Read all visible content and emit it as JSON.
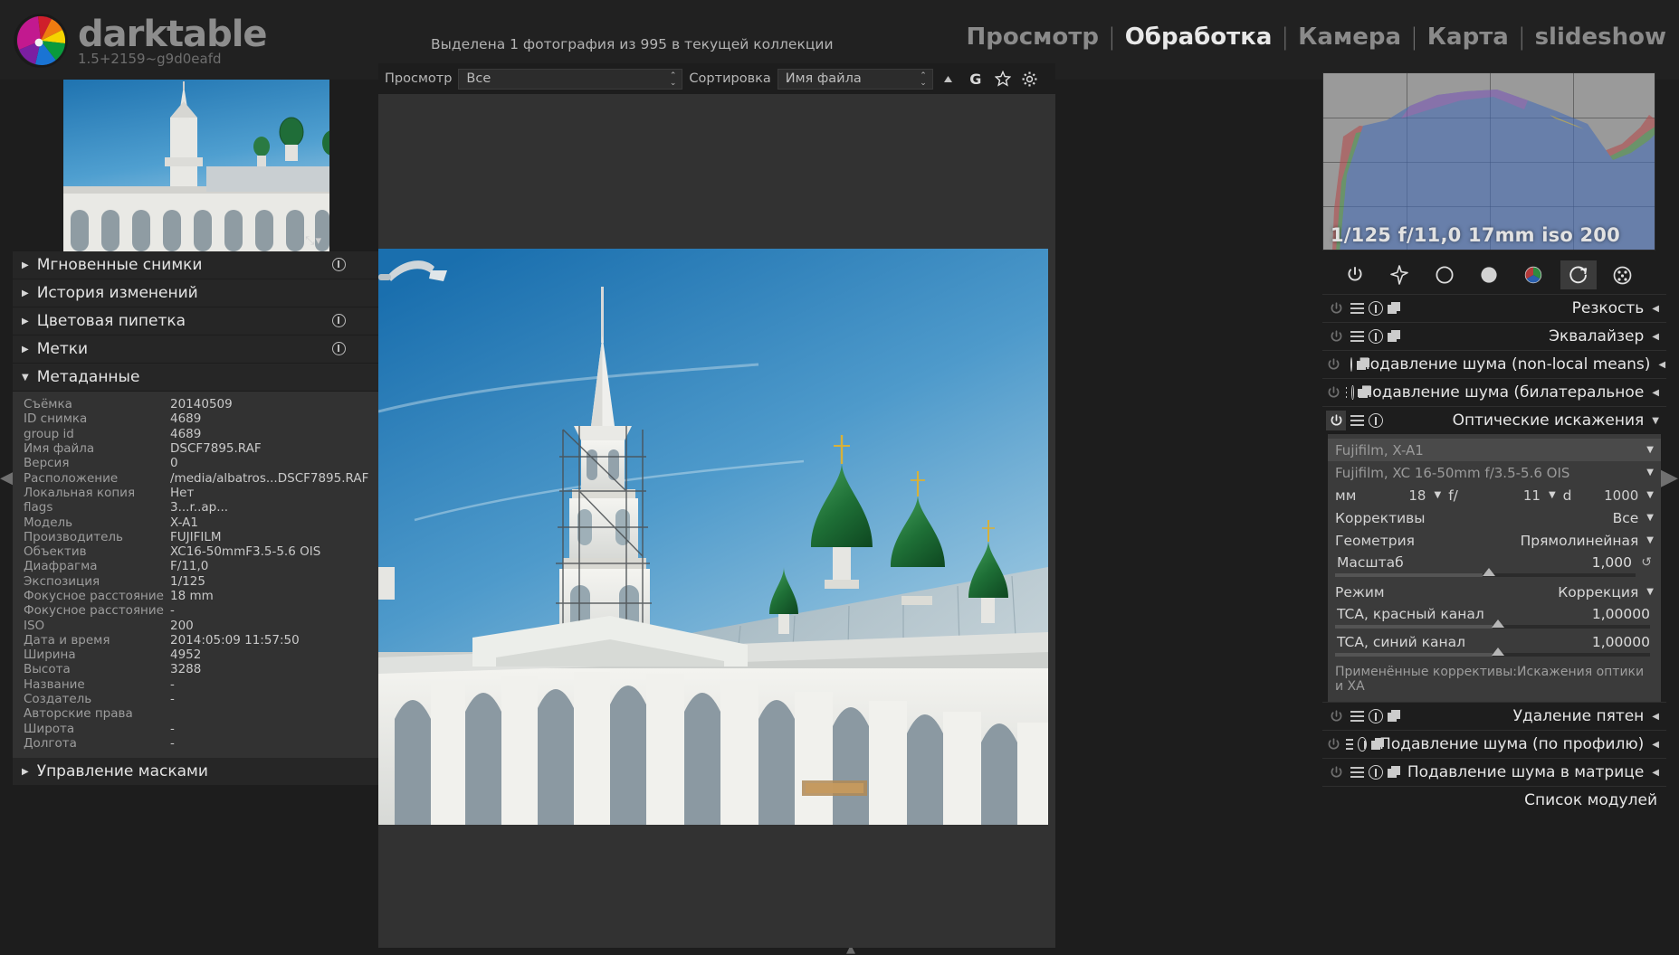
{
  "app": {
    "name": "darktable",
    "version": "1.5+2159~g9d0eafd",
    "collection_status": "Выделена 1 фотография из 995 в текущей коллекции"
  },
  "viewnav": {
    "items": [
      {
        "label": "Просмотр",
        "active": false
      },
      {
        "label": "Обработка",
        "active": true
      },
      {
        "label": "Камера",
        "active": false
      },
      {
        "label": "Карта",
        "active": false
      },
      {
        "label": "slideshow",
        "active": false
      }
    ],
    "separator": "|"
  },
  "toolbar": {
    "view_label": "Просмотр",
    "view_value": "Все",
    "sort_label": "Сортировка",
    "sort_value": "Имя файла",
    "asc_icon": "triangle-up-icon",
    "group_icon": "G",
    "overlay_icon": "star-icon",
    "prefs_icon": "gear-icon"
  },
  "left_panel": {
    "thumb_resize_icon": "resize-icon",
    "sections": [
      {
        "label": "Мгновенные снимки",
        "expanded": false,
        "has_reset": true
      },
      {
        "label": "История изменений",
        "expanded": false,
        "has_reset": false
      },
      {
        "label": "Цветовая пипетка",
        "expanded": false,
        "has_reset": true
      },
      {
        "label": "Метки",
        "expanded": false,
        "has_reset": true
      },
      {
        "label": "Метаданные",
        "expanded": true,
        "has_reset": false
      }
    ],
    "masks_section": {
      "label": "Управление масками",
      "expanded": false
    },
    "metadata": [
      {
        "key": "Съёмка",
        "value": "20140509"
      },
      {
        "key": "ID снимка",
        "value": "4689"
      },
      {
        "key": "group id",
        "value": "4689"
      },
      {
        "key": "Имя файла",
        "value": "DSCF7895.RAF"
      },
      {
        "key": "Версия",
        "value": "0"
      },
      {
        "key": "Расположение",
        "value": "/media/albatros...DSCF7895.RAF"
      },
      {
        "key": "Локальная копия",
        "value": "Нет"
      },
      {
        "key": "flags",
        "value": "3...r..ap..."
      },
      {
        "key": "Модель",
        "value": "X-A1"
      },
      {
        "key": "Производитель",
        "value": "FUJIFILM"
      },
      {
        "key": "Объектив",
        "value": "XC16-50mmF3.5-5.6 OIS"
      },
      {
        "key": "Диафрагма",
        "value": "F/11,0"
      },
      {
        "key": "Экспозиция",
        "value": "1/125"
      },
      {
        "key": "Фокусное расстояние",
        "value": "18 mm"
      },
      {
        "key": "Фокусное расстояние",
        "value": "-"
      },
      {
        "key": "ISO",
        "value": "200"
      },
      {
        "key": "Дата и время",
        "value": "2014:05:09 11:57:50"
      },
      {
        "key": "Ширина",
        "value": "4952"
      },
      {
        "key": "Высота",
        "value": "3288"
      },
      {
        "key": "Название",
        "value": "-"
      },
      {
        "key": "Создатель",
        "value": "-"
      },
      {
        "key": "Авторские права",
        "value": ""
      },
      {
        "key": "Широта",
        "value": "-"
      },
      {
        "key": "Долгота",
        "value": "-"
      }
    ]
  },
  "right_panel": {
    "histogram_exif": "1/125 f/11,0 17mm iso 200",
    "group_icons": [
      {
        "name": "power-icon",
        "selected": false
      },
      {
        "name": "star-effects-icon",
        "selected": false
      },
      {
        "name": "circle-outline-icon",
        "selected": false
      },
      {
        "name": "circle-filled-icon",
        "selected": false
      },
      {
        "name": "color-wheel-icon",
        "selected": false
      },
      {
        "name": "correct-icon",
        "selected": true
      },
      {
        "name": "effects-icon",
        "selected": false
      }
    ],
    "modules": [
      {
        "label": "Резкость",
        "power": false,
        "expanded": false,
        "has_duplicate": true
      },
      {
        "label": "Эквалайзер",
        "power": false,
        "expanded": false,
        "has_duplicate": true
      },
      {
        "label": "Подавление шума (non-local means)",
        "power": false,
        "expanded": false,
        "has_duplicate": true
      },
      {
        "label": "Подавление шума (билатеральное",
        "power": false,
        "expanded": false,
        "has_duplicate": true
      },
      {
        "label": "Оптические искажения",
        "power": true,
        "expanded": true,
        "has_duplicate": false
      }
    ],
    "modules_after": [
      {
        "label": "Удаление пятен",
        "power": false,
        "expanded": false,
        "has_duplicate": true
      },
      {
        "label": "Подавление шума (по профилю)",
        "power": false,
        "expanded": false,
        "has_duplicate": true
      },
      {
        "label": "Подавление шума в матрице",
        "power": false,
        "expanded": false,
        "has_duplicate": true
      }
    ],
    "module_list_label": "Список модулей",
    "lens": {
      "camera": "Fujifilm, X-A1",
      "lens": "Fujifilm, XC 16-50mm f/3.5-5.6 OIS",
      "mm_label": "мм",
      "mm_value": "18",
      "f_label": "f/",
      "f_value": "11",
      "d_label": "d",
      "d_value": "1000",
      "corrections_label": "Коррективы",
      "corrections_value": "Все",
      "geometry_label": "Геометрия",
      "geometry_value": "Прямолинейная",
      "scale_label": "Масштаб",
      "scale_value": "1,000",
      "mode_label": "Режим",
      "mode_value": "Коррекция",
      "tca_red_label": "TCA, красный канал",
      "tca_red_value": "1,00000",
      "tca_blue_label": "TCA, синий канал",
      "tca_blue_value": "1,00000",
      "applied_note": "Применённые коррективы:Искажения оптики и ХА"
    }
  },
  "edges": {
    "top": "▲",
    "bottom": "▲",
    "left": "◀",
    "right": "▶"
  }
}
